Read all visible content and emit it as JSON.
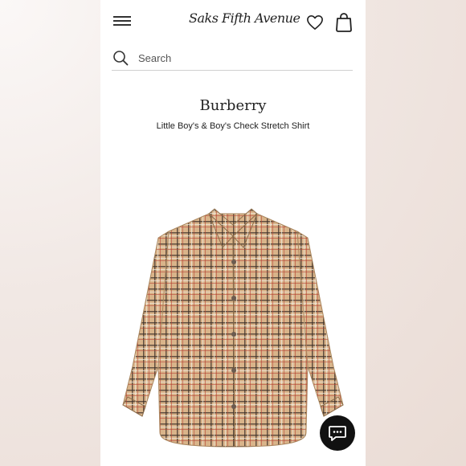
{
  "header": {
    "logo_text": "Saks Fifth Avenue",
    "icons": {
      "menu": "hamburger-menu-icon",
      "wishlist": "heart-icon",
      "bag": "shopping-bag-icon"
    }
  },
  "search": {
    "placeholder": "Search",
    "icon": "search-icon"
  },
  "product": {
    "brand": "Burberry",
    "name": "Little Boy's & Boy's Check Stretch Shirt",
    "image": "check-shirt-image"
  },
  "chat": {
    "icon": "chat-bubble-icon"
  },
  "colors": {
    "shirt_base": "#d9b48a",
    "check_dark": "#3a2f28",
    "check_red": "#b33b2f",
    "chat_bg": "#111111"
  }
}
